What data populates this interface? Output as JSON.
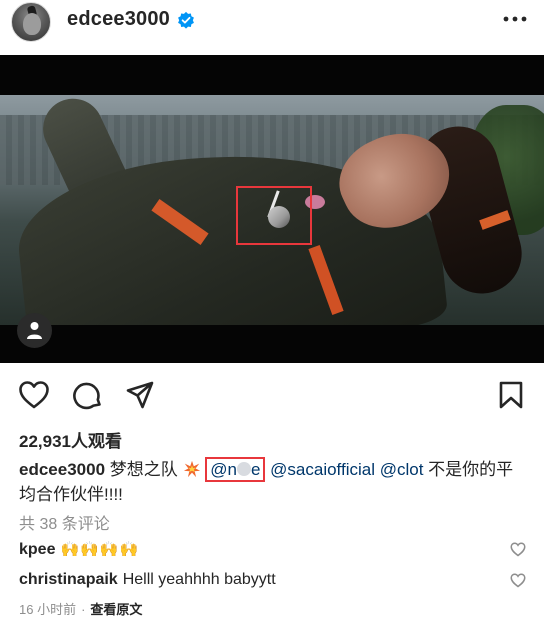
{
  "header": {
    "username": "edcee3000",
    "verified": true,
    "avatar_icon": "profile-avatar",
    "more_icon": "ellipsis-icon"
  },
  "media": {
    "type": "video",
    "user_tag_icon": "person-icon"
  },
  "actions": {
    "like_icon": "heart-icon",
    "comment_icon": "speech-bubble-icon",
    "share_icon": "paper-plane-icon",
    "save_icon": "bookmark-icon"
  },
  "post": {
    "views_label": "22,931人观看",
    "caption": {
      "username": "edcee3000",
      "text_before": "梦想之队",
      "mention_1": "@n",
      "mention_1_tail": "e",
      "mention_2": "@sacaiofficial",
      "mention_3": "@clot",
      "text_after": "不是你的平均合作伙伴!!!!"
    },
    "view_comments": "共 38 条评论",
    "comments": [
      {
        "username": "kpee",
        "text": "🙌🙌🙌🙌"
      },
      {
        "username": "christinapaik",
        "text": "Helll yeahhhh babyytt"
      }
    ],
    "time_ago": "16 小时前",
    "separator": "·",
    "see_translation": "查看原文"
  },
  "colors": {
    "mention": "#00376b",
    "annotation": "#e8373c",
    "verified": "#0095f6",
    "muted": "#8e8e8e"
  }
}
